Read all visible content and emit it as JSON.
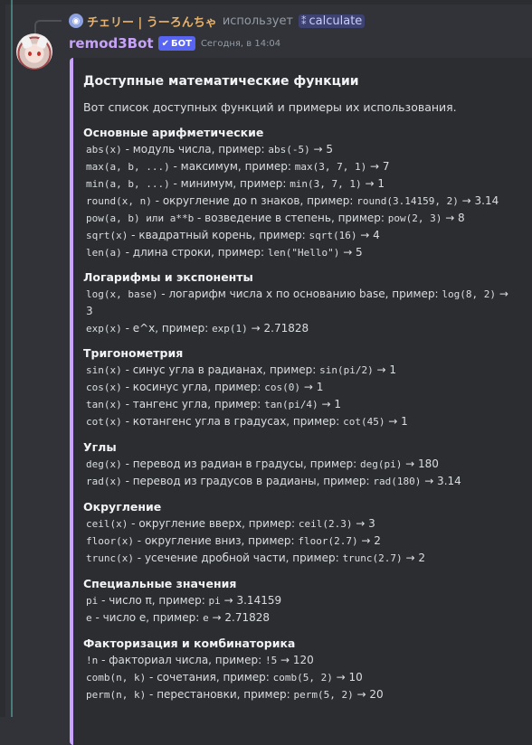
{
  "reply": {
    "user": "チェリー | うーろんちゃ",
    "uses_label": "использует",
    "command": "calculate"
  },
  "message": {
    "username": "remod3Bot",
    "bot_badge": "БОТ",
    "timestamp": "Сегодня, в 14:04"
  },
  "embed": {
    "title": "Доступные математические функции",
    "description": "Вот список доступных функций и примеры их использования.",
    "sections": [
      {
        "name": "Основные арифметические",
        "lines": [
          [
            "abs(x)",
            " - модуль числа, пример: ",
            "abs(-5)",
            " → 5"
          ],
          [
            "max(a, b, ...)",
            " - максимум, пример: ",
            "max(3, 7, 1)",
            " → 7"
          ],
          [
            "min(a, b, ...)",
            " - минимум, пример: ",
            "min(3, 7, 1)",
            " → 1"
          ],
          [
            "round(x, n)",
            " - округление до n знаков, пример: ",
            "round(3.14159, 2)",
            " → 3.14"
          ],
          [
            "pow(a, b) или a**b",
            " - возведение в степень, пример: ",
            "pow(2, 3)",
            " → 8"
          ],
          [
            "sqrt(x)",
            " - квадратный корень, пример: ",
            "sqrt(16)",
            " → 4"
          ],
          [
            "len(a)",
            " - длина строки, пример: ",
            "len(\"Hello\")",
            " → 5"
          ]
        ]
      },
      {
        "name": "Логарифмы и экспоненты",
        "lines": [
          [
            "log(x, base)",
            " - логарифм числа x по основанию base, пример: ",
            "log(8, 2)",
            " →"
          ],
          [
            "",
            "3",
            "",
            ""
          ],
          [
            "exp(x)",
            " - e^x, пример: ",
            "exp(1)",
            " → 2.71828"
          ]
        ]
      },
      {
        "name": "Тригонометрия",
        "lines": [
          [
            "sin(x)",
            " - синус угла в радианах, пример: ",
            "sin(pi/2)",
            " → 1"
          ],
          [
            "cos(x)",
            " - косинус угла, пример: ",
            "cos(0)",
            " → 1"
          ],
          [
            "tan(x)",
            " - тангенс угла, пример: ",
            "tan(pi/4)",
            " → 1"
          ],
          [
            "cot(x)",
            " - котангенс угла в градусах, пример: ",
            "cot(45)",
            " → 1"
          ]
        ]
      },
      {
        "name": "Углы",
        "lines": [
          [
            "deg(x)",
            " - перевод из радиан в градусы, пример: ",
            "deg(pi)",
            " → 180"
          ],
          [
            "rad(x)",
            " - перевод из градусов в радианы, пример: ",
            "rad(180)",
            " → 3.14"
          ]
        ]
      },
      {
        "name": "Округление",
        "lines": [
          [
            "ceil(x)",
            " - округление вверх, пример: ",
            "ceil(2.3)",
            " → 3"
          ],
          [
            "floor(x)",
            " - округление вниз, пример: ",
            "floor(2.7)",
            " → 2"
          ],
          [
            "trunc(x)",
            " - усечение дробной части, пример: ",
            "trunc(2.7)",
            " → 2"
          ]
        ]
      },
      {
        "name": "Специальные значения",
        "lines": [
          [
            "pi",
            " - число π, пример: ",
            "pi",
            " → 3.14159"
          ],
          [
            "e",
            " - число e, пример: ",
            "e",
            " → 2.71828"
          ]
        ]
      },
      {
        "name": "Факторизация и комбинаторика",
        "lines": [
          [
            "!n",
            " - факториал числа, пример: ",
            "!5",
            " → 120"
          ],
          [
            "comb(n, k)",
            " - сочетания, пример: ",
            "comb(5, 2)",
            " → 10"
          ],
          [
            "perm(n, k)",
            " - перестановки, пример: ",
            "perm(5, 2)",
            " → 20"
          ]
        ]
      }
    ]
  },
  "colors": {
    "background": "#313338",
    "embed_background": "#2b2d31",
    "embed_accent": "#c9a1ff",
    "username": "#c6a2f7",
    "bot_badge": "#5865f2",
    "reply_user": "#e8b26a"
  }
}
